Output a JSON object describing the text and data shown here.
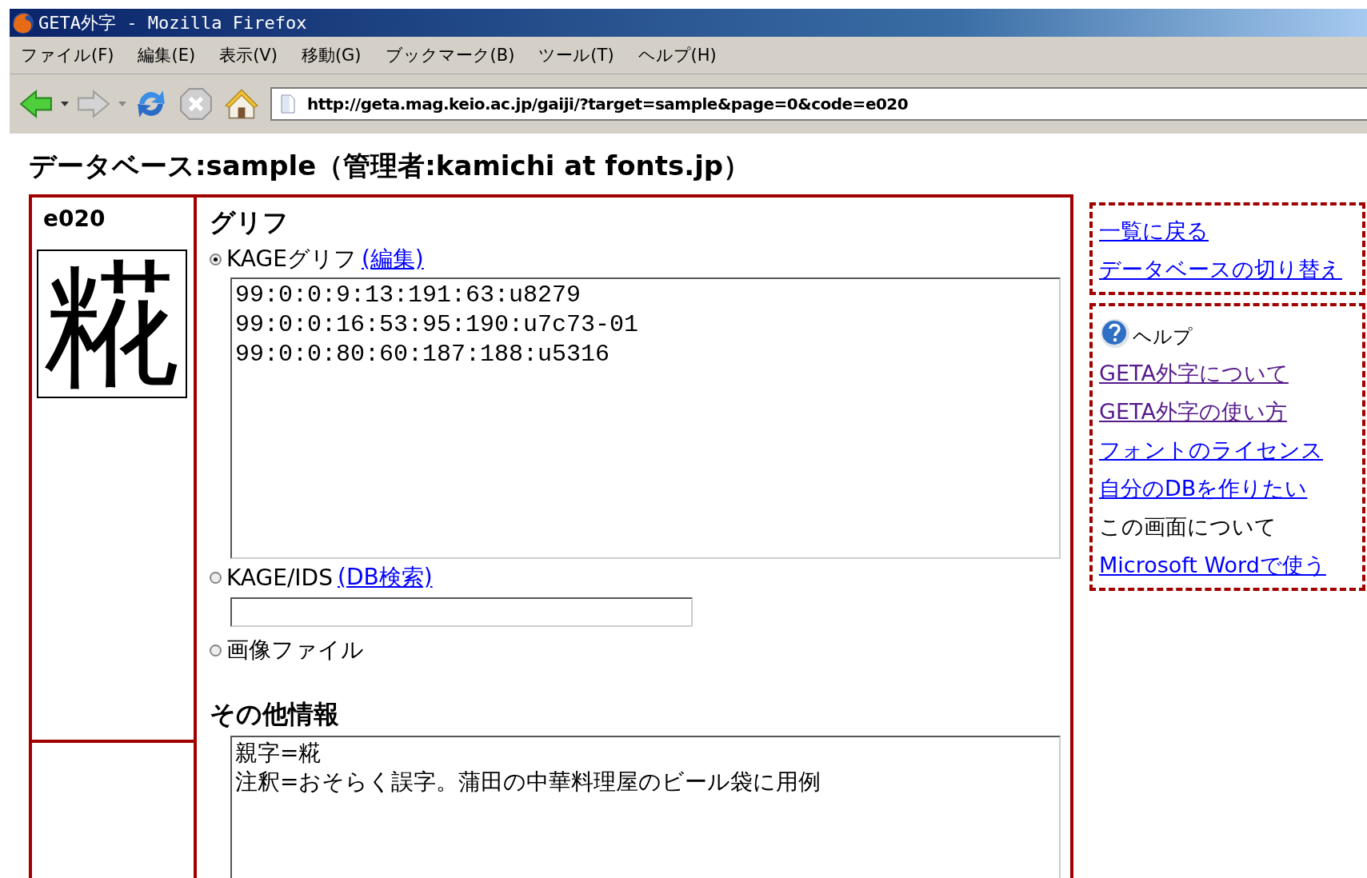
{
  "window": {
    "title": "GETA外字 - Mozilla Firefox"
  },
  "menu_bar": [
    "ファイル(F)",
    "編集(E)",
    "表示(V)",
    "移動(G)",
    "ブックマーク(B)",
    "ツール(T)",
    "ヘルプ(H)"
  ],
  "address_bar": {
    "value": "http://geta.mag.keio.ac.jp/gaiji/?target=sample&page=0&code=e020"
  },
  "page": {
    "heading": "データベース:sample（管理者:kamichi at fonts.jp）",
    "code": "e020",
    "glyph": "糀",
    "glyph_section": {
      "heading": "グリフ",
      "options": [
        {
          "label": "KAGEグリフ",
          "link": "(編集)",
          "selected": true,
          "kind": "textarea",
          "lines": [
            "99:0:0:9:13:191:63:u8279",
            "99:0:0:16:53:95:190:u7c73-01",
            "99:0:0:80:60:187:188:u5316"
          ]
        },
        {
          "label": "KAGE/IDS",
          "link": "(DB検索)",
          "selected": false,
          "kind": "input"
        },
        {
          "label": "画像ファイル",
          "selected": false,
          "kind": "none"
        }
      ]
    },
    "other_info": {
      "heading": "その他情報",
      "lines": [
        "親字=糀",
        "注釈=おそらく誤字。蒲田の中華料理屋のビール袋に用例"
      ]
    }
  },
  "sidebar": {
    "nav_links": [
      "一覧に戻る",
      "データベースの切り替え"
    ],
    "help": {
      "heading": "ヘルプ",
      "items": [
        {
          "label": "GETA外字について",
          "kind": "link",
          "visited": true
        },
        {
          "label": "GETA外字の使い方",
          "kind": "link",
          "visited": true
        },
        {
          "label": "フォントのライセンス",
          "kind": "link",
          "visited": false
        },
        {
          "label": "自分のDBを作りたい",
          "kind": "link",
          "visited": false
        },
        {
          "label": "この画面について",
          "kind": "text"
        },
        {
          "label": "Microsoft Wordで使う",
          "kind": "link",
          "visited": false
        }
      ]
    }
  }
}
